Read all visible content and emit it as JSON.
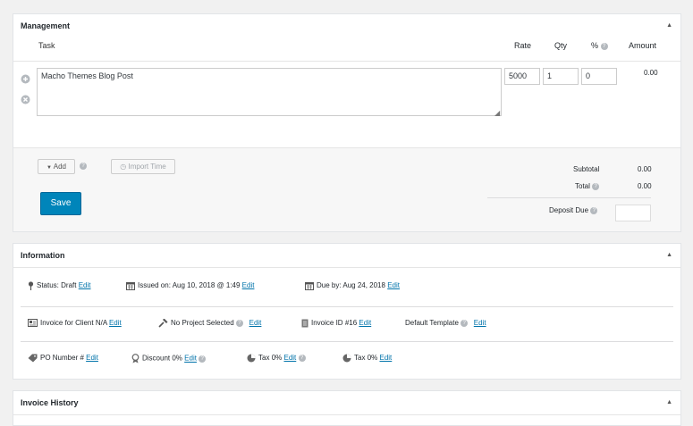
{
  "management": {
    "title": "Management",
    "headers": {
      "task": "Task",
      "rate": "Rate",
      "qty": "Qty",
      "pct": "%",
      "amount": "Amount"
    },
    "row": {
      "task": "Macho Themes Blog Post",
      "rate": "5000",
      "qty": "1",
      "pct": "0",
      "amount": "0.00"
    },
    "add_label": "Add",
    "import_label": "Import Time",
    "save_label": "Save",
    "subtotal_label": "Subtotal",
    "subtotal_value": "0.00",
    "total_label": "Total",
    "total_value": "0.00",
    "deposit_label": "Deposit Due",
    "deposit_value": ""
  },
  "information": {
    "title": "Information",
    "status_label": "Status:",
    "status_value": "Draft",
    "issued_label": "Issued on:",
    "issued_value": "Aug 10, 2018 @ 1:49",
    "due_label": "Due by:",
    "due_value": "Aug 24, 2018",
    "invoice_for": "Invoice for",
    "client": "Client N/A",
    "project": "No Project Selected",
    "invoice_id_label": "Invoice ID",
    "invoice_id": "#16",
    "template": "Default Template",
    "po_label": "PO Number #",
    "discount_label": "Discount",
    "discount_value": "0%",
    "tax1_label": "Tax",
    "tax1_value": "0%",
    "tax2_label": "Tax",
    "tax2_value": "0%",
    "edit_label": "Edit"
  },
  "history": {
    "title": "Invoice History"
  },
  "icons": [
    "plus-circle-icon",
    "x-circle-icon",
    "help-icon",
    "clock-icon",
    "pin-icon",
    "calendar-icon",
    "id-card-icon",
    "hammer-icon",
    "document-icon",
    "tag-icon",
    "badge-icon",
    "pie-icon",
    "collapse-arrow-icon"
  ]
}
